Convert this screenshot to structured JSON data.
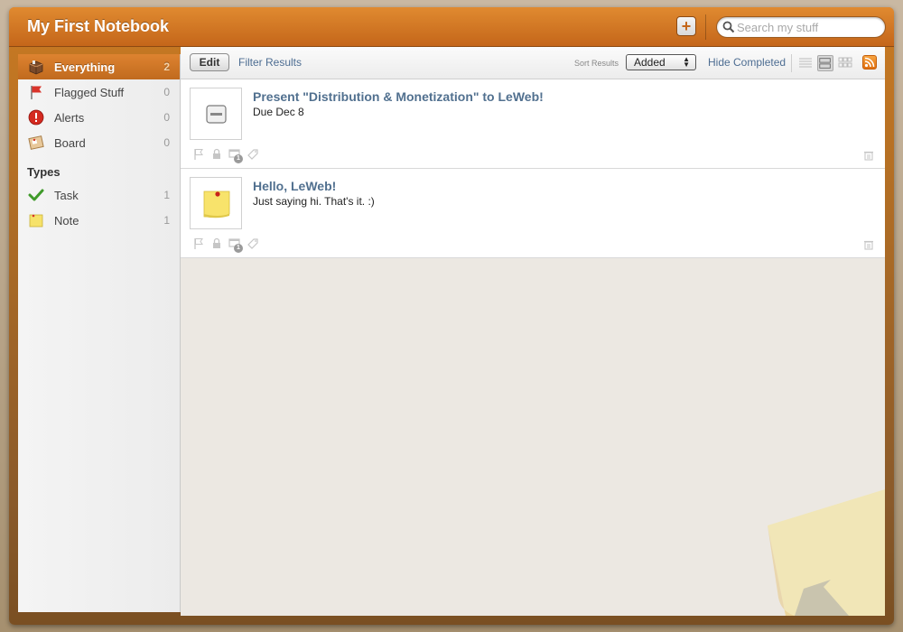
{
  "app": {
    "title": "My First Notebook"
  },
  "search": {
    "placeholder": "Search my stuff",
    "value": ""
  },
  "sidebar": {
    "items": [
      {
        "label": "Everything",
        "count": "2",
        "icon": "box-icon",
        "active": true
      },
      {
        "label": "Flagged Stuff",
        "count": "0",
        "icon": "flag-icon",
        "active": false
      },
      {
        "label": "Alerts",
        "count": "0",
        "icon": "alert-icon",
        "active": false
      },
      {
        "label": "Board",
        "count": "0",
        "icon": "board-icon",
        "active": false
      }
    ],
    "types_heading": "Types",
    "types": [
      {
        "label": "Task",
        "count": "1",
        "icon": "checkmark-icon"
      },
      {
        "label": "Note",
        "count": "1",
        "icon": "note-icon"
      }
    ]
  },
  "toolbar": {
    "edit_label": "Edit",
    "filter_label": "Filter Results",
    "sort_label": "Sort Results",
    "sort_value": "Added",
    "hide_completed_label": "Hide Completed",
    "selected_view": "list-medium"
  },
  "items": [
    {
      "title": "Present \"Distribution & Monetization\" to LeWeb!",
      "subtitle": "Due Dec 8",
      "type": "task",
      "attachment_count": "1"
    },
    {
      "title": "Hello, LeWeb!",
      "subtitle": "Just saying hi. That's it. :)",
      "type": "note",
      "attachment_count": "1"
    }
  ],
  "colors": {
    "accent_orange": "#d4762a",
    "link_blue": "#4d6d92",
    "title_blue": "#51708f"
  }
}
